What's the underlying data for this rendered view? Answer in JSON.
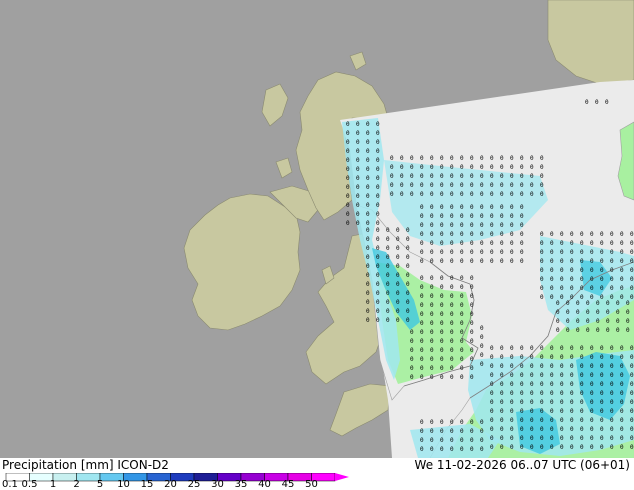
{
  "map": {
    "title_left": "Precipitation [mm]  ICON-D2",
    "title_right": "We 11-02-2026 06..07 UTC (06+01)",
    "colors": {
      "sea": "#a0a0a0",
      "land_outside": "#c8c8a0",
      "land_inside": "#ebebeb",
      "domain_sea": "#ebebeb",
      "light_rain": "#a8f0a0",
      "rain_cyan": "#a0e8f0",
      "rain_teal": "#40c8e0",
      "borders": "#707070"
    },
    "rain_value_glyph": "0"
  },
  "legend": {
    "tick_labels": [
      "0.1",
      "0.5",
      "1",
      "2",
      "5",
      "10",
      "15",
      "20",
      "25",
      "30",
      "35",
      "40",
      "45",
      "50"
    ],
    "colors": [
      "#ffffff",
      "#e6ffff",
      "#c8f0f0",
      "#a0e6f0",
      "#64c8f0",
      "#3296e6",
      "#2864d2",
      "#1e3cbe",
      "#1e1e96",
      "#6400c8",
      "#9600d2",
      "#c800e6",
      "#e600e6",
      "#ff00ff"
    ]
  }
}
